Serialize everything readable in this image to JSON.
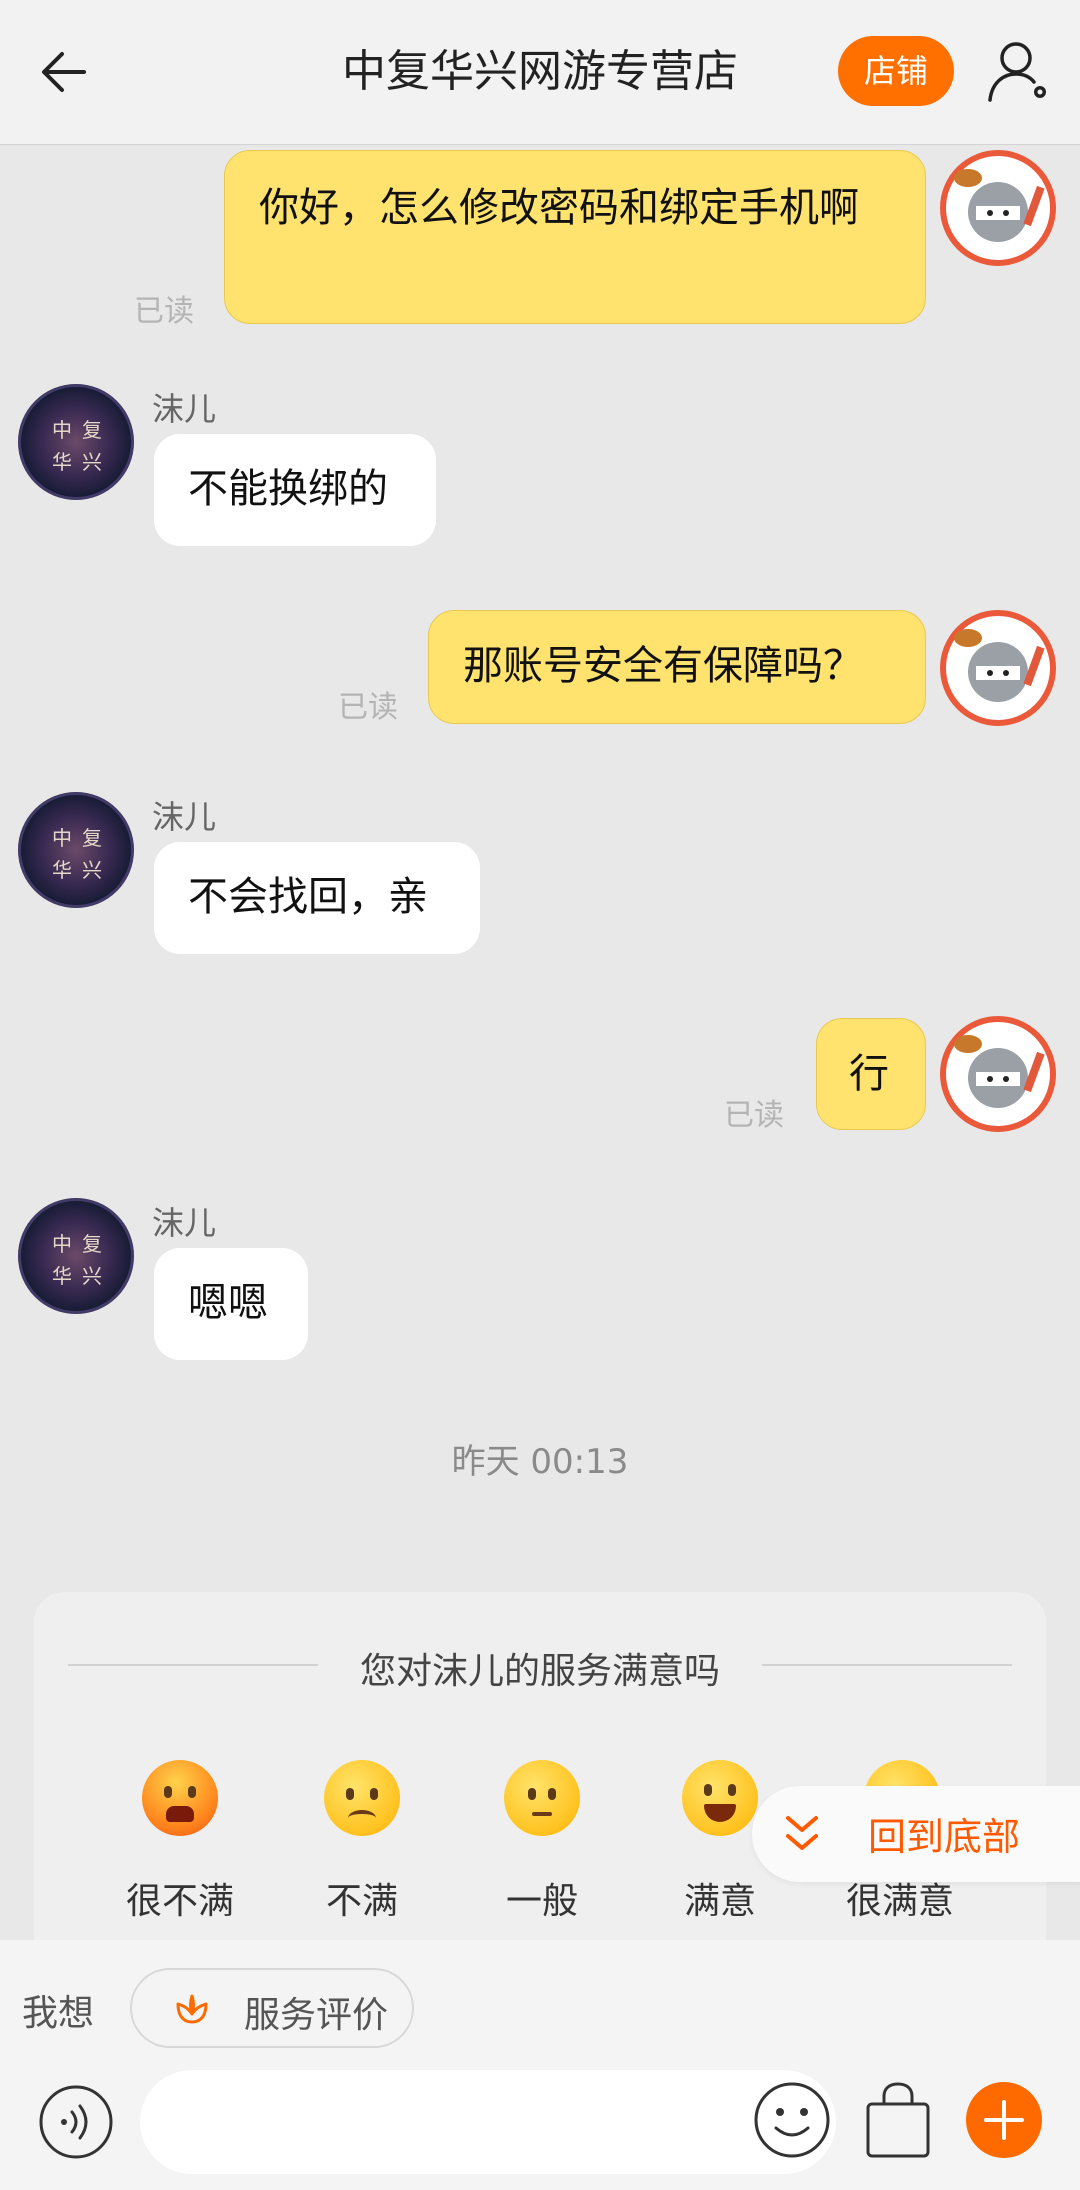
{
  "header": {
    "title": "中复华兴网游专营店",
    "shop_button": "店铺"
  },
  "messages": [
    {
      "type": "mine",
      "text": "你好，怎么修改密码和绑定手机啊",
      "status": "已读"
    },
    {
      "type": "theirs",
      "sender": "沫儿",
      "text": "不能换绑的"
    },
    {
      "type": "mine",
      "text": "那账号安全有保障吗？",
      "status": "已读"
    },
    {
      "type": "theirs",
      "sender": "沫儿",
      "text": "不会找回，亲"
    },
    {
      "type": "mine",
      "text": "行",
      "status": "已读"
    },
    {
      "type": "theirs",
      "sender": "沫儿",
      "text": "嗯嗯"
    }
  ],
  "shop_avatar_chars": [
    "中",
    "复",
    "华",
    "兴"
  ],
  "timestamp": "昨天  00:13",
  "rating": {
    "title": "您对沫儿的服务满意吗",
    "options": [
      "很不满",
      "不满",
      "一般",
      "满意",
      "很满意"
    ]
  },
  "back_to_bottom": "回到底部",
  "bottom_bar": {
    "prefix": "我想",
    "chip_label": "服务评价"
  },
  "colors": {
    "accent": "#ff7000",
    "my_bubble": "#ffe36e",
    "their_bubble": "#ffffff",
    "background": "#e8e8e8"
  },
  "icons": [
    "back-arrow-icon",
    "user-settings-icon",
    "voice-icon",
    "emoji-icon",
    "shopping-bag-icon",
    "plus-icon",
    "double-chevron-down-icon",
    "flower-icon"
  ]
}
